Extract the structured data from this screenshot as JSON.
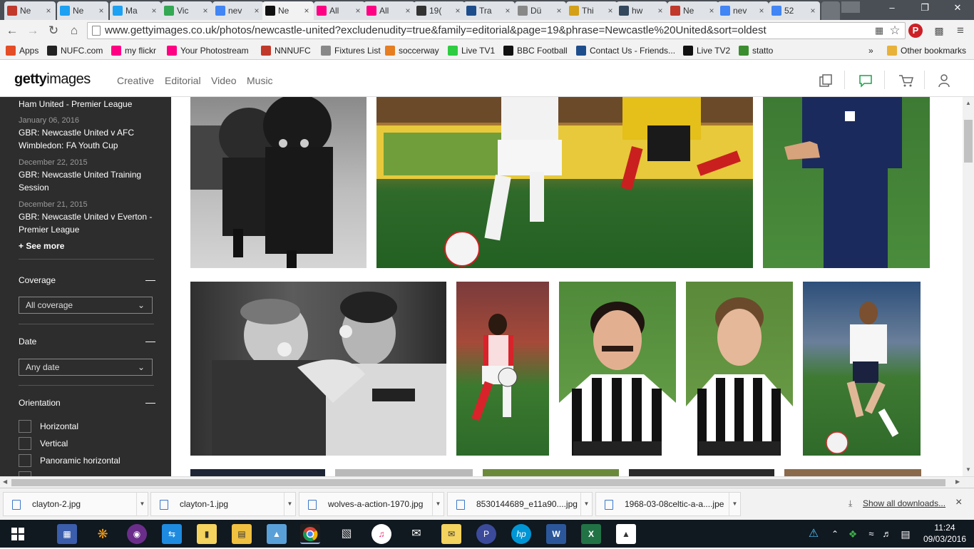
{
  "browser": {
    "tabs": [
      {
        "label": "Ne",
        "icon": "nnn-icon",
        "color": "#c0392b"
      },
      {
        "label": "Ne",
        "icon": "twitter-icon",
        "color": "#1da1f2"
      },
      {
        "label": "Ma",
        "icon": "twitter-icon",
        "color": "#1da1f2"
      },
      {
        "label": "Vic",
        "icon": "maps-icon",
        "color": "#34a853"
      },
      {
        "label": "nev",
        "icon": "google-icon",
        "color": "#4285f4"
      },
      {
        "label": "Ne",
        "icon": "gettyimages-icon",
        "color": "#111111"
      },
      {
        "label": "All",
        "icon": "flickr-icon",
        "color": "#ff0084"
      },
      {
        "label": "All",
        "icon": "flickr-icon",
        "color": "#ff0084"
      },
      {
        "label": "19(",
        "icon": "a-icon",
        "color": "#333333"
      },
      {
        "label": "Tra",
        "icon": "dus-icon",
        "color": "#1e4d8c"
      },
      {
        "label": "Dü",
        "icon": "page-icon",
        "color": "#888888"
      },
      {
        "label": "Thi",
        "icon": "triangle-icon",
        "color": "#d4a017"
      },
      {
        "label": "hw",
        "icon": "hw-icon",
        "color": "#34495e"
      },
      {
        "label": "Ne",
        "icon": "nnn-icon",
        "color": "#c0392b"
      },
      {
        "label": "nev",
        "icon": "google-icon",
        "color": "#4285f4"
      },
      {
        "label": "52",
        "icon": "google-icon",
        "color": "#4285f4"
      }
    ],
    "url": "www.gettyimages.co.uk/photos/newcastle-united?excludenudity=true&family=editorial&page=19&phrase=Newcastle%20United&sort=oldest",
    "bookmarks": [
      {
        "label": "Apps",
        "icon": "apps-icon",
        "color": "#e44d26"
      },
      {
        "label": "NUFC.com",
        "icon": "nufc-icon",
        "color": "#222222"
      },
      {
        "label": "my flickr",
        "icon": "flickr-icon",
        "color": "#ff0084"
      },
      {
        "label": "Your Photostream",
        "icon": "flickr-icon",
        "color": "#ff0084"
      },
      {
        "label": "NNNUFC",
        "icon": "nnn-icon",
        "color": "#c0392b"
      },
      {
        "label": "Fixtures List",
        "icon": "page-icon",
        "color": "#888888"
      },
      {
        "label": "soccerway",
        "icon": "soccerway-icon",
        "color": "#e67e22"
      },
      {
        "label": "Live TV1",
        "icon": "live-icon",
        "color": "#2ecc40"
      },
      {
        "label": "BBC Football",
        "icon": "bbc-icon",
        "color": "#111111"
      },
      {
        "label": "Contact Us - Friends...",
        "icon": "contact-icon",
        "color": "#1e4d8c"
      },
      {
        "label": "Live TV2",
        "icon": "ball-icon",
        "color": "#111111"
      },
      {
        "label": "statto",
        "icon": "statto-icon",
        "color": "#3c8d2f"
      }
    ],
    "bookmarks_more": "»",
    "other_bookmarks": "Other bookmarks"
  },
  "site": {
    "logo_bold": "getty",
    "logo_rest": "images",
    "nav": [
      "Creative",
      "Editorial",
      "Video",
      "Music"
    ]
  },
  "sidebar": {
    "events": [
      {
        "date": "",
        "title": "Ham United - Premier League"
      },
      {
        "date": "January 06, 2016",
        "title": "GBR: Newcastle United v AFC Wimbledon: FA Youth Cup"
      },
      {
        "date": "December 22, 2015",
        "title": "GBR: Newcastle United Training Session"
      },
      {
        "date": "December 21, 2015",
        "title": "GBR: Newcastle United v Everton - Premier League"
      }
    ],
    "see_more": "+ See more",
    "coverage": {
      "title": "Coverage",
      "value": "All coverage"
    },
    "date": {
      "title": "Date",
      "value": "Any date"
    },
    "orientation": {
      "title": "Orientation",
      "options": [
        "Horizontal",
        "Vertical",
        "Panoramic horizontal"
      ]
    },
    "collapse_symbol": "—"
  },
  "downloads": {
    "items": [
      "clayton-2.jpg",
      "clayton-1.jpg",
      "wolves-a-action-1970.jpg",
      "8530144689_e11a90....jpg",
      "1968-03-08celtic-a-a....jpe"
    ],
    "show_all": "Show all downloads...",
    "close": "×"
  },
  "taskbar": {
    "time": "11:24",
    "date": "09/03/2016"
  }
}
